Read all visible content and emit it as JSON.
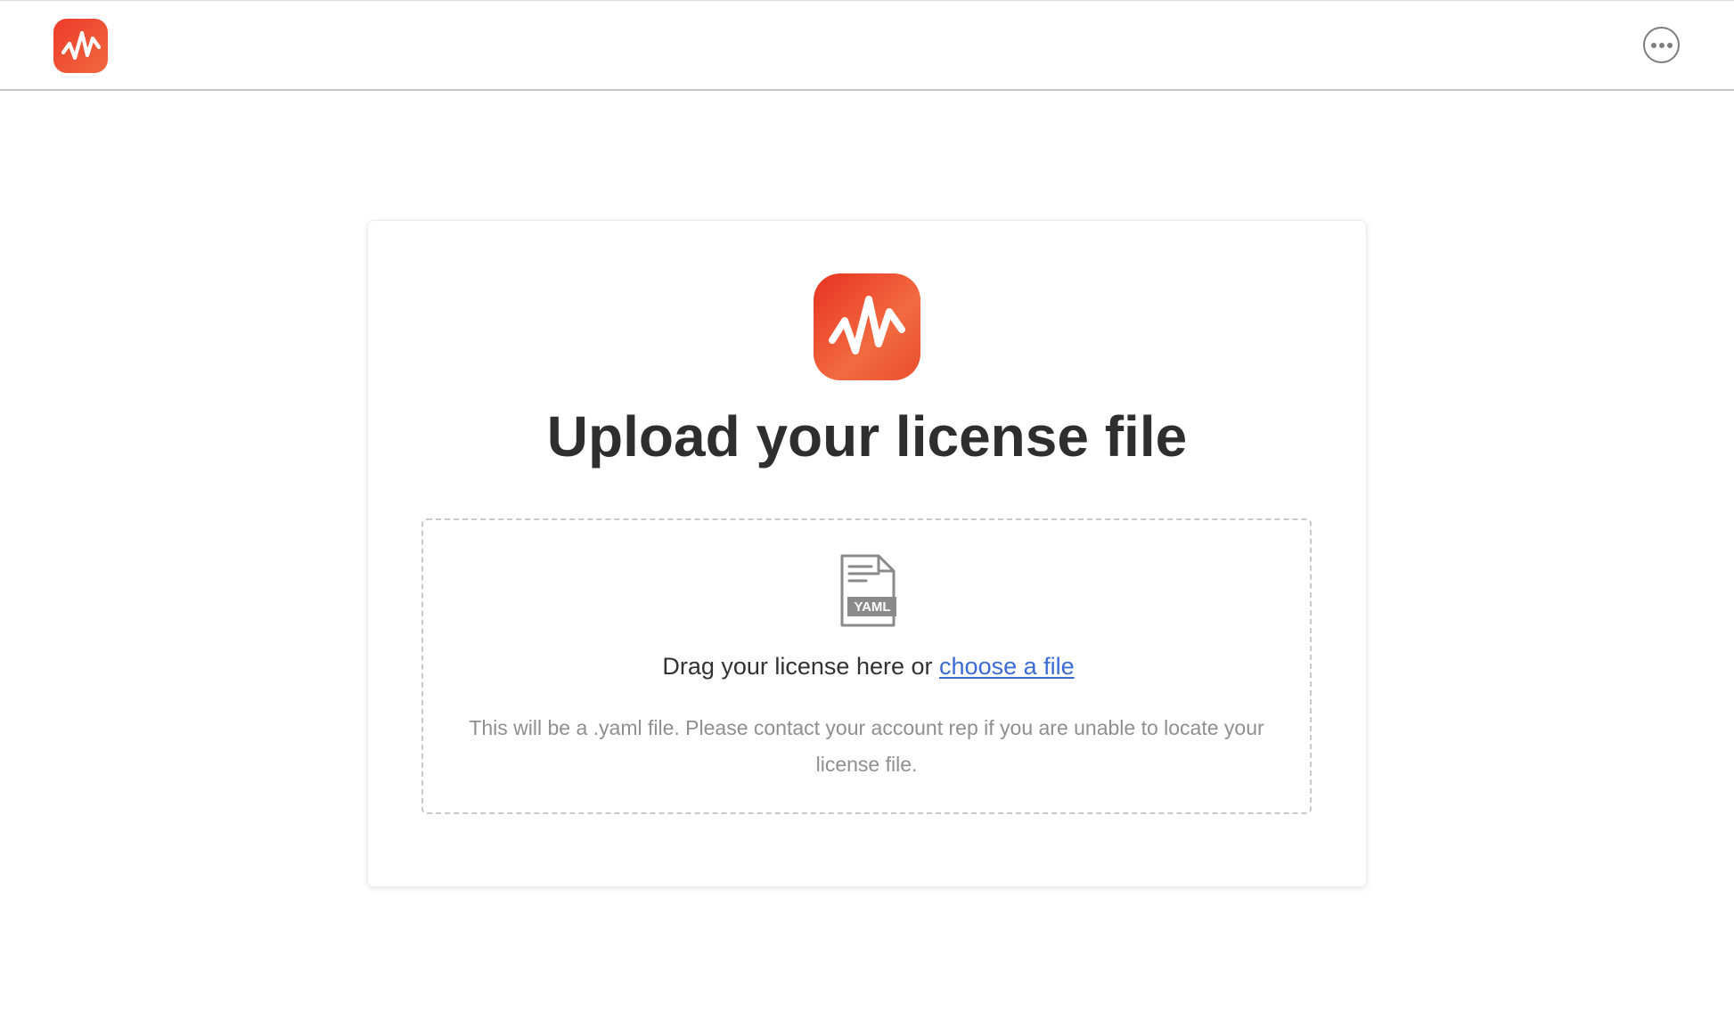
{
  "header": {
    "logo_icon": "waveform-logo-icon",
    "more_icon": "ellipsis-icon"
  },
  "card": {
    "logo_icon": "waveform-logo-icon",
    "title": "Upload your license file",
    "dropzone": {
      "file_icon": "yaml-file-icon",
      "file_badge": "YAML",
      "drag_text": "Drag your license here or",
      "choose_link": "choose a file",
      "help_text": "This will be a .yaml file. Please contact your account rep if you are unable to locate your license file."
    }
  },
  "colors": {
    "brand_orange": "#ec4a2e",
    "link_blue": "#3b6bd6",
    "muted_text": "#8f8f8f",
    "dashed_border": "#c9c9c9"
  }
}
